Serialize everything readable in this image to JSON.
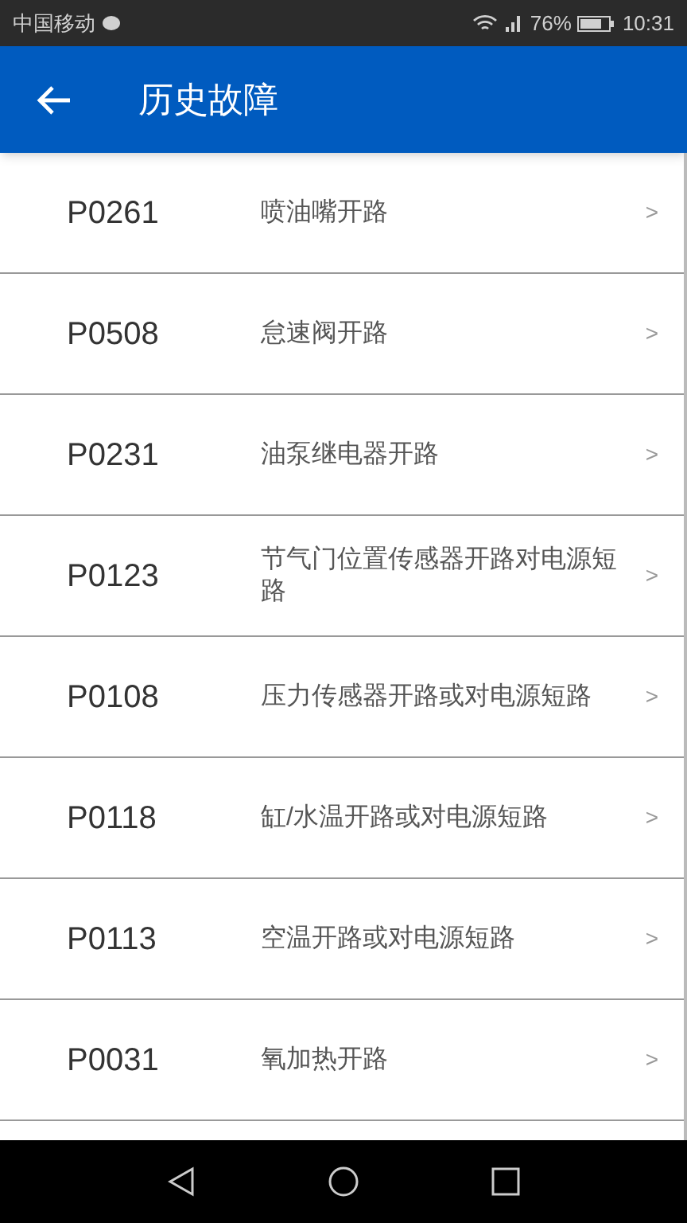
{
  "status_bar": {
    "carrier": "中国移动",
    "battery": "76%",
    "time": "10:31"
  },
  "app_bar": {
    "title": "历史故障"
  },
  "faults": [
    {
      "code": "P0261",
      "description": "喷油嘴开路",
      "chevron": ">"
    },
    {
      "code": "P0508",
      "description": "怠速阀开路",
      "chevron": ">"
    },
    {
      "code": "P0231",
      "description": "油泵继电器开路",
      "chevron": ">"
    },
    {
      "code": "P0123",
      "description": "节气门位置传感器开路对电源短路",
      "chevron": ">"
    },
    {
      "code": "P0108",
      "description": "压力传感器开路或对电源短路",
      "chevron": ">"
    },
    {
      "code": "P0118",
      "description": "缸/水温开路或对电源短路",
      "chevron": ">"
    },
    {
      "code": "P0113",
      "description": "空温开路或对电源短路",
      "chevron": ">"
    },
    {
      "code": "P0031",
      "description": "氧加热开路",
      "chevron": ">"
    }
  ]
}
